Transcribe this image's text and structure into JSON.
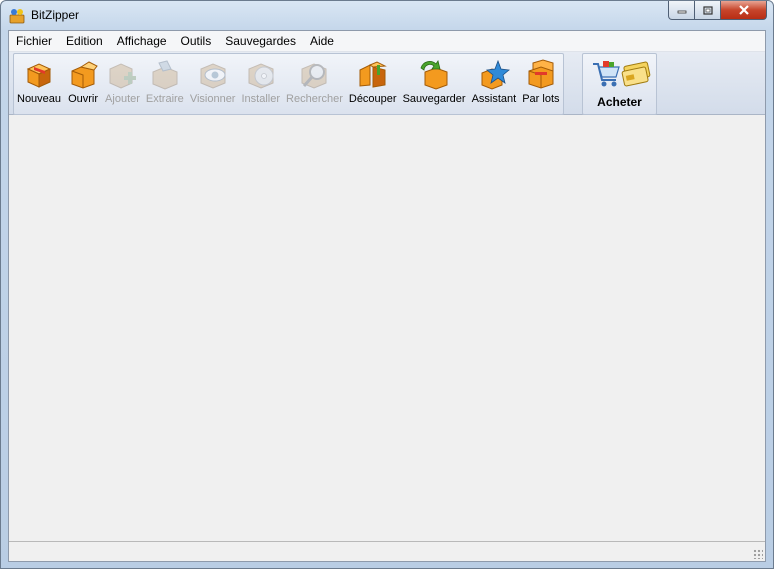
{
  "window": {
    "title": "BitZipper"
  },
  "menu": [
    "Fichier",
    "Edition",
    "Affichage",
    "Outils",
    "Sauvegardes",
    "Aide"
  ],
  "toolbar": [
    {
      "label": "Nouveau",
      "icon": "new-archive-icon",
      "enabled": true
    },
    {
      "label": "Ouvrir",
      "icon": "open-archive-icon",
      "enabled": true
    },
    {
      "label": "Ajouter",
      "icon": "add-files-icon",
      "enabled": false
    },
    {
      "label": "Extraire",
      "icon": "extract-icon",
      "enabled": false
    },
    {
      "label": "Visionner",
      "icon": "view-eye-icon",
      "enabled": false
    },
    {
      "label": "Installer",
      "icon": "install-disc-icon",
      "enabled": false
    },
    {
      "label": "Rechercher",
      "icon": "search-magnifier-icon",
      "enabled": false
    },
    {
      "label": "Découper",
      "icon": "split-archive-icon",
      "enabled": true
    },
    {
      "label": "Sauvegarder",
      "icon": "backup-icon",
      "enabled": true
    },
    {
      "label": "Assistant",
      "icon": "wizard-star-icon",
      "enabled": true
    },
    {
      "label": "Par lots",
      "icon": "batch-archive-icon",
      "enabled": true
    }
  ],
  "buy": {
    "label": "Acheter",
    "icons": [
      "shopping-cart-icon",
      "credit-card-icon"
    ]
  },
  "colors": {
    "box_orange": "#f39a1f",
    "box_dark": "#c8650c",
    "accent_green": "#4aa42c",
    "accent_blue": "#2f8ad8"
  }
}
